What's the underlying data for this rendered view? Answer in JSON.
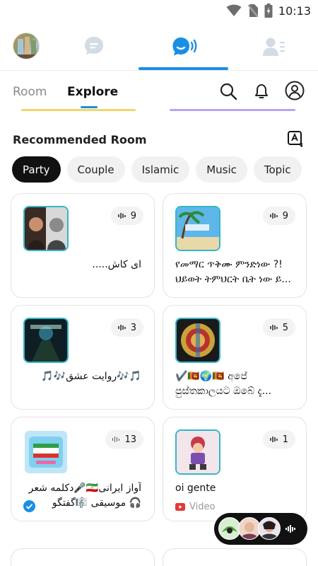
{
  "status_bar": {
    "time": "10:13"
  },
  "top_nav": {
    "items": [
      "profile",
      "messages",
      "live-room",
      "contacts"
    ],
    "active": "live-room"
  },
  "sub_tabs": {
    "room": "Room",
    "explore": "Explore"
  },
  "section": {
    "title": "Recommended Room"
  },
  "categories": [
    "Party",
    "Couple",
    "Islamic",
    "Music",
    "Topic"
  ],
  "rooms": [
    {
      "title": "ای کاش.....",
      "count": "9"
    },
    {
      "title": "የመማር ጥቅሙ ምንድነው ?! ህይወት ትምህርት ቤት ነው ይ...",
      "count": "9"
    },
    {
      "title": "🎵🎶روایت عشق🎶🎵",
      "count": "3"
    },
    {
      "title": "✔️🇱🇰🌍🇱🇰 අපේ පුස්තකාලයට ඔබේ දැ...",
      "count": "5"
    },
    {
      "title": "آواز ایرانی🇮🇷🎤دکلمه شعر🎧 موسیقی 🎼گفتگو",
      "count": "13"
    },
    {
      "title": "oi gente",
      "count": "1",
      "footer": "Video"
    }
  ],
  "colors": {
    "accent": "#1a8fe3",
    "active_chip": "#111111",
    "thumb_border": "#34b6c9"
  }
}
